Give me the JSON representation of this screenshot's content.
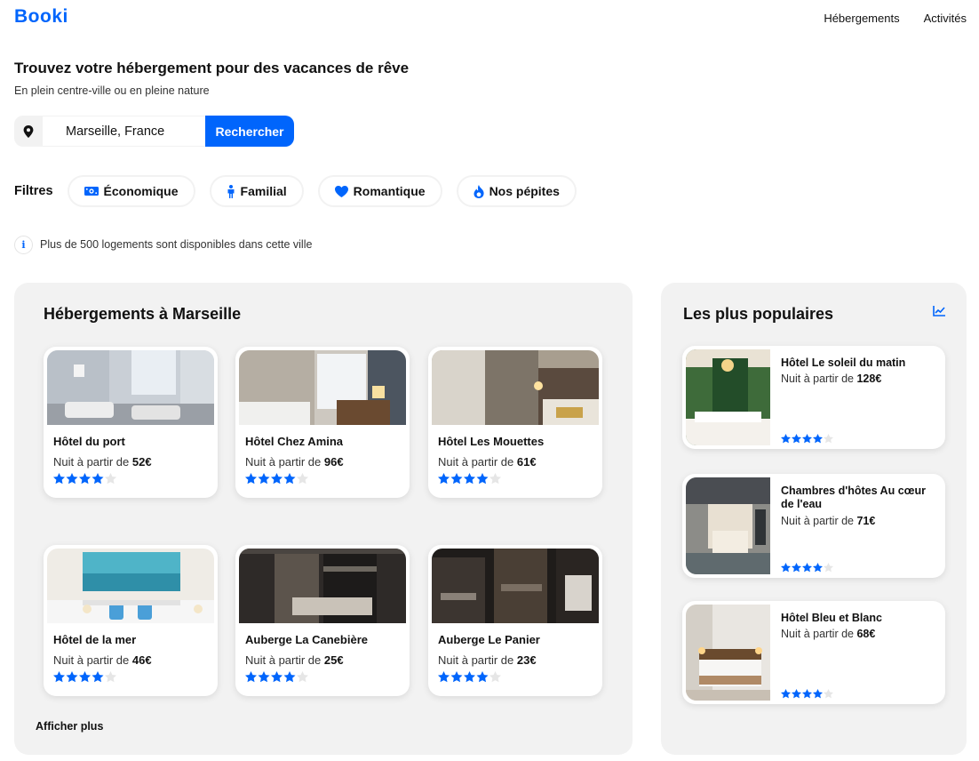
{
  "header": {
    "logo": "Booki",
    "nav": [
      "Hébergements",
      "Activités"
    ]
  },
  "hero": {
    "title": "Trouvez votre hébergement pour des vacances de rêve",
    "subtitle": "En plein centre-ville ou en pleine nature"
  },
  "search": {
    "value": "Marseille, France",
    "button_label": "Rechercher",
    "pin_icon": "location-pin-icon"
  },
  "filters": {
    "label": "Filtres",
    "chips": [
      {
        "label": "Économique",
        "icon": "money-icon"
      },
      {
        "label": "Familial",
        "icon": "person-icon"
      },
      {
        "label": "Romantique",
        "icon": "heart-icon"
      },
      {
        "label": "Nos pépites",
        "icon": "fire-icon"
      }
    ]
  },
  "info": {
    "icon": "info-icon",
    "text": "Plus de 500 logements sont disponibles dans cette ville"
  },
  "hebergements": {
    "title": "Hébergements à Marseille",
    "price_prefix": "Nuit à partir de",
    "currency": "€",
    "more_label": "Afficher plus",
    "items": [
      {
        "name": "Hôtel du port",
        "price": "52",
        "rating": 4
      },
      {
        "name": "Hôtel Chez Amina",
        "price": "96",
        "rating": 4
      },
      {
        "name": "Hôtel Les Mouettes",
        "price": "61",
        "rating": 4
      },
      {
        "name": "Hôtel de la mer",
        "price": "46",
        "rating": 4
      },
      {
        "name": "Auberge La Canebière",
        "price": "25",
        "rating": 4
      },
      {
        "name": "Auberge Le Panier",
        "price": "23",
        "rating": 4
      }
    ]
  },
  "populaires": {
    "title": "Les plus populaires",
    "icon": "chart-line-icon",
    "items": [
      {
        "name": "Hôtel Le soleil du matin",
        "price": "128",
        "rating": 4
      },
      {
        "name": "Chambres d'hôtes Au cœur de l'eau",
        "price": "71",
        "rating": 4
      },
      {
        "name": "Hôtel Bleu et Blanc",
        "price": "68",
        "rating": 4
      }
    ]
  },
  "colors": {
    "accent": "#0065FC",
    "panel_bg": "#F2F2F2",
    "star_empty": "#E6E6E6"
  }
}
